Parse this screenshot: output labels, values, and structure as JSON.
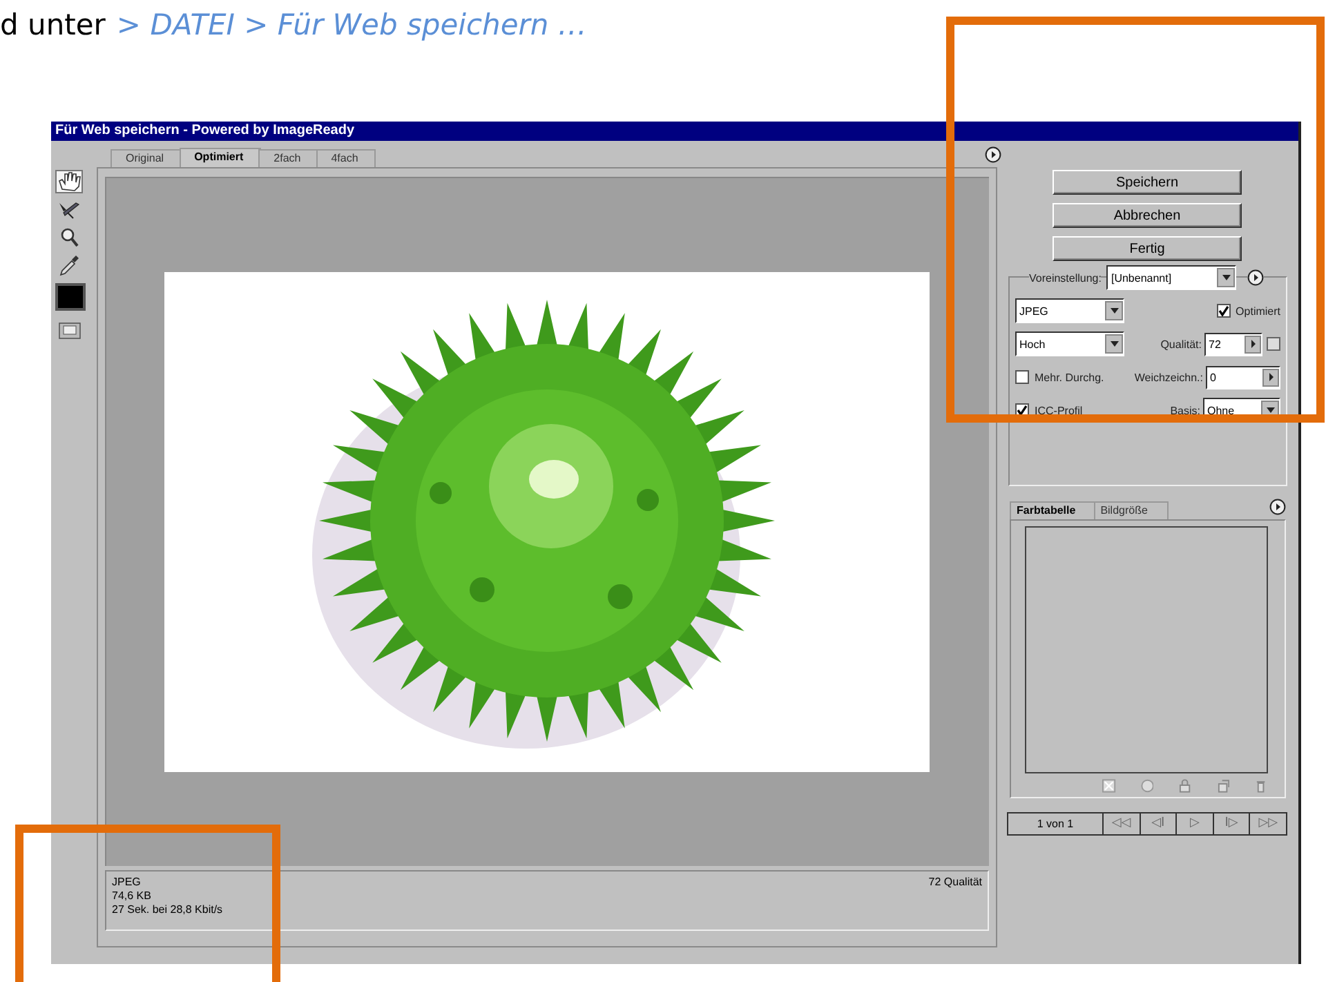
{
  "intro": {
    "text": "d unter",
    "menu_path": "> DATEI > Für Web speichern …"
  },
  "window": {
    "title": "Für Web speichern - Powered by ImageReady"
  },
  "tabs": [
    {
      "label": "Original",
      "selected": false
    },
    {
      "label": "Optimiert",
      "selected": true
    },
    {
      "label": "2fach",
      "selected": false
    },
    {
      "label": "4fach",
      "selected": false
    }
  ],
  "tools": [
    {
      "kind": "hand",
      "selected": true
    },
    {
      "kind": "slice",
      "selected": false
    },
    {
      "kind": "zoom",
      "selected": false
    },
    {
      "kind": "eyedropper",
      "selected": false
    },
    {
      "kind": "swatch",
      "color": "#000000"
    },
    {
      "kind": "preview",
      "selected": false
    }
  ],
  "info": {
    "lines": [
      "JPEG",
      "74,6 KB",
      "27 Sek. bei 28,8 Kbit/s"
    ],
    "quality": "72 Qualität"
  },
  "buttons": [
    "Speichern",
    "Abbrechen",
    "Fertig"
  ],
  "settings": {
    "preset_label": "Voreinstellung:",
    "preset": "[Unbenannt]",
    "format": "JPEG",
    "quality_level": "Hoch",
    "optimized": {
      "label": "Optimiert",
      "checked": true
    },
    "quality": {
      "label": "Qualität:",
      "value": "72"
    },
    "progressive": {
      "label": "Mehr. Durchg.",
      "checked": false
    },
    "blur": {
      "label": "Weichzeichn.:",
      "value": "0"
    },
    "icc": {
      "label": "ICC-Profil",
      "checked": true
    },
    "matte": {
      "label": "Basis:",
      "value": "Ohne"
    }
  },
  "panel_tabs": [
    {
      "label": "Farbtabelle",
      "selected": true
    },
    {
      "label": "Bildgröße",
      "selected": false
    }
  ],
  "pager": {
    "label": "1 von 1",
    "buttons": [
      "◁◁",
      "◁I",
      "▷",
      "I▷",
      "▷▷"
    ]
  }
}
